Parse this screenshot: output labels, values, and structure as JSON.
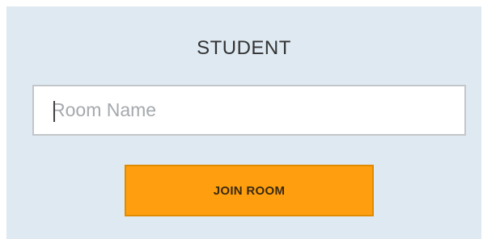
{
  "panel": {
    "title": "STUDENT"
  },
  "room_input": {
    "placeholder": "Room Name",
    "value": ""
  },
  "join_button": {
    "label": "JOIN ROOM"
  },
  "colors": {
    "panel_background": "#dfe9f2",
    "button_background": "#ff9f0f",
    "button_border": "#e08a00",
    "input_border": "#c3c6c9"
  }
}
